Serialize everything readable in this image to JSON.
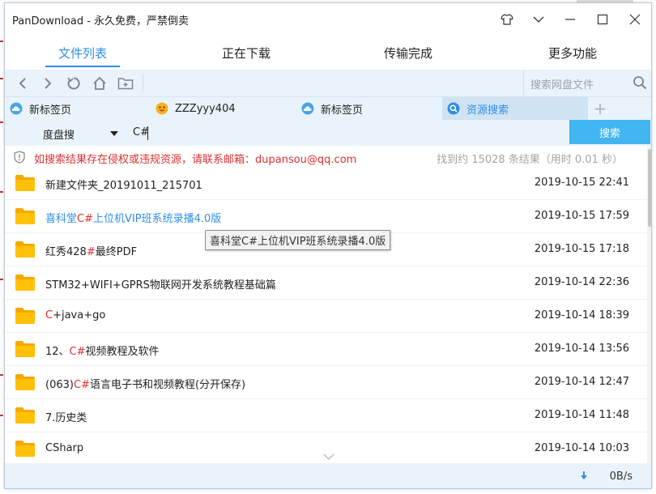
{
  "window": {
    "title": "PanDownload - 永久免费，严禁倒卖"
  },
  "title_buttons": [
    {
      "name": "shirt-skin-icon"
    },
    {
      "name": "chevron-down-icon"
    },
    {
      "name": "minimize-icon"
    },
    {
      "name": "maximize-icon"
    },
    {
      "name": "close-icon"
    }
  ],
  "tabs": [
    {
      "label": "文件列表",
      "active": true
    },
    {
      "label": "正在下载",
      "active": false
    },
    {
      "label": "传输完成",
      "active": false
    },
    {
      "label": "更多功能",
      "active": false
    }
  ],
  "toolbar": {
    "icons": [
      "back-arrow-icon",
      "forward-arrow-icon",
      "refresh-icon",
      "home-icon",
      "new-folder-icon"
    ],
    "search_placeholder": "搜索网盘文件"
  },
  "browser_tabs": [
    {
      "label": "新标签页",
      "icon": "cloud-icon",
      "active": false
    },
    {
      "label": "ZZZyyy404",
      "icon": "emoji-avatar-icon",
      "active": false
    },
    {
      "label": "新标签页",
      "icon": "cloud-icon",
      "active": false
    },
    {
      "label": "资源搜索",
      "icon": "search-icon",
      "active": true
    }
  ],
  "search": {
    "engine": "度盘搜",
    "query": "C#",
    "button_label": "搜索"
  },
  "notice": {
    "message": "如搜索结果存在侵权或违规资源，请联系邮箱：dupansou@qq.com",
    "result_count": "找到约 15028 条结果（用时 0.01 秒）"
  },
  "results": [
    {
      "parts": [
        {
          "t": "新建文件夹_20191011_215701",
          "h": false
        }
      ],
      "date": "2019-10-15 22:41",
      "link": false
    },
    {
      "parts": [
        {
          "t": "喜科堂",
          "h": false
        },
        {
          "t": "C#",
          "h": true
        },
        {
          "t": "上位机VIP班系统录播4.0版",
          "h": false
        }
      ],
      "date": "2019-10-15 17:59",
      "link": true
    },
    {
      "parts": [
        {
          "t": "红秀428",
          "h": false
        },
        {
          "t": "#",
          "h": true
        },
        {
          "t": "最终PDF",
          "h": false
        }
      ],
      "date": "2019-10-15 17:18",
      "link": false
    },
    {
      "parts": [
        {
          "t": "STM32+WIFI+GPRS物联网开发系统教程基础篇",
          "h": false
        }
      ],
      "date": "2019-10-14 22:36",
      "link": false
    },
    {
      "parts": [
        {
          "t": "C",
          "h": true
        },
        {
          "t": "+java+go",
          "h": false
        }
      ],
      "date": "2019-10-14 18:39",
      "link": false
    },
    {
      "parts": [
        {
          "t": "12、",
          "h": false
        },
        {
          "t": "C#",
          "h": true
        },
        {
          "t": "视频教程及软件",
          "h": false
        }
      ],
      "date": "2019-10-14 13:56",
      "link": false
    },
    {
      "parts": [
        {
          "t": "(063)",
          "h": false
        },
        {
          "t": "C#",
          "h": true
        },
        {
          "t": "语言电子书和视频教程(分开保存)",
          "h": false
        }
      ],
      "date": "2019-10-14 12:47",
      "link": false
    },
    {
      "parts": [
        {
          "t": "7.历史类",
          "h": false
        }
      ],
      "date": "2019-10-14 11:48",
      "link": false
    },
    {
      "parts": [
        {
          "t": "CSharp",
          "h": false
        }
      ],
      "date": "2019-10-14 10:03",
      "link": false
    }
  ],
  "tooltip": "喜科堂C#上位机VIP班系统录播4.0版",
  "status": {
    "speed": "0B/s"
  },
  "colors": {
    "accent": "#2f8ee8",
    "highlight": "#e03030",
    "button": "#41b6f0",
    "folder": "#ffc107",
    "toolbar_bg": "#e9f3fb"
  }
}
